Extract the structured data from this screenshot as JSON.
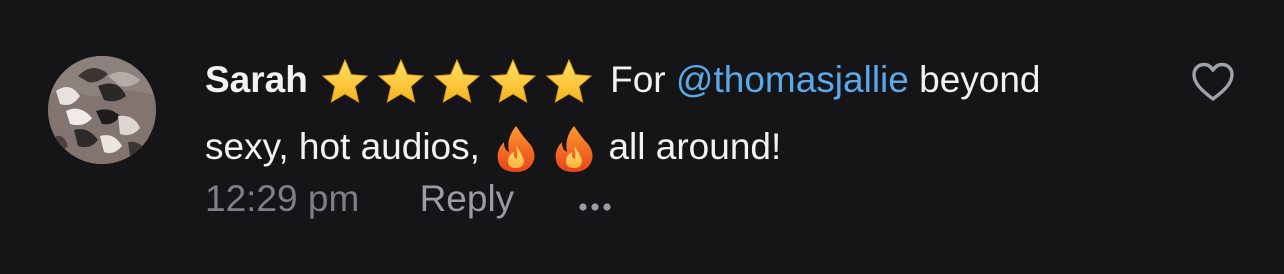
{
  "comment": {
    "author": "Sarah",
    "text_prefix": "For",
    "mention": "@thomasjallie",
    "text_after_mention": "beyond",
    "line2_text": "sexy, hot audios,",
    "line2_end": "all around!",
    "star_count": 5,
    "fire_count": 2,
    "timestamp": "12:29 pm",
    "reply_label": "Reply",
    "more_icon": "ellipsis-icon",
    "like_icon": "heart-outline-icon",
    "avatar_icon": "user-avatar"
  },
  "colors": {
    "background": "#151517",
    "text": "#f2f2f4",
    "mention": "#5aa9ea",
    "meta": "#7e8088",
    "star": "#f7c630",
    "fire": "#f2611c"
  }
}
